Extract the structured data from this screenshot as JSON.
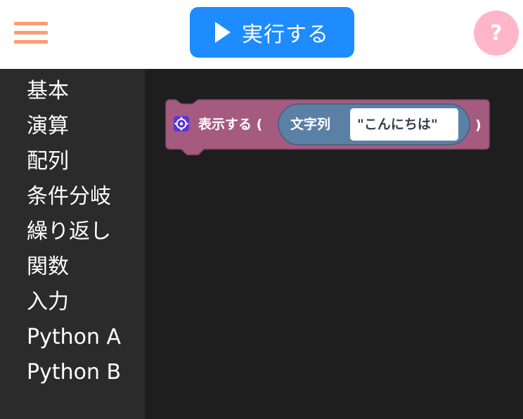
{
  "header": {
    "run_label": "実行する",
    "help_label": "?"
  },
  "toolbox": {
    "items": [
      {
        "label": "基本"
      },
      {
        "label": "演算"
      },
      {
        "label": "配列"
      },
      {
        "label": "条件分岐"
      },
      {
        "label": "繰り返し"
      },
      {
        "label": "関数"
      },
      {
        "label": "入力"
      },
      {
        "label": "Python A"
      },
      {
        "label": "Python B"
      }
    ]
  },
  "workspace": {
    "print_block": {
      "label": "表示する (",
      "close_paren": ")",
      "color": "#A55B80",
      "icon": "gear-icon",
      "string_block": {
        "type_label": "文字列",
        "value": "\"こんにちは\"",
        "color": "#5B80A5"
      }
    }
  },
  "colors": {
    "menu_accent": "#FF9B71",
    "run_button": "#1E8CFF",
    "help_button": "#FFB6C8",
    "toolbox_bg": "#2B2B2B",
    "workspace_bg": "#1E1E1E"
  }
}
